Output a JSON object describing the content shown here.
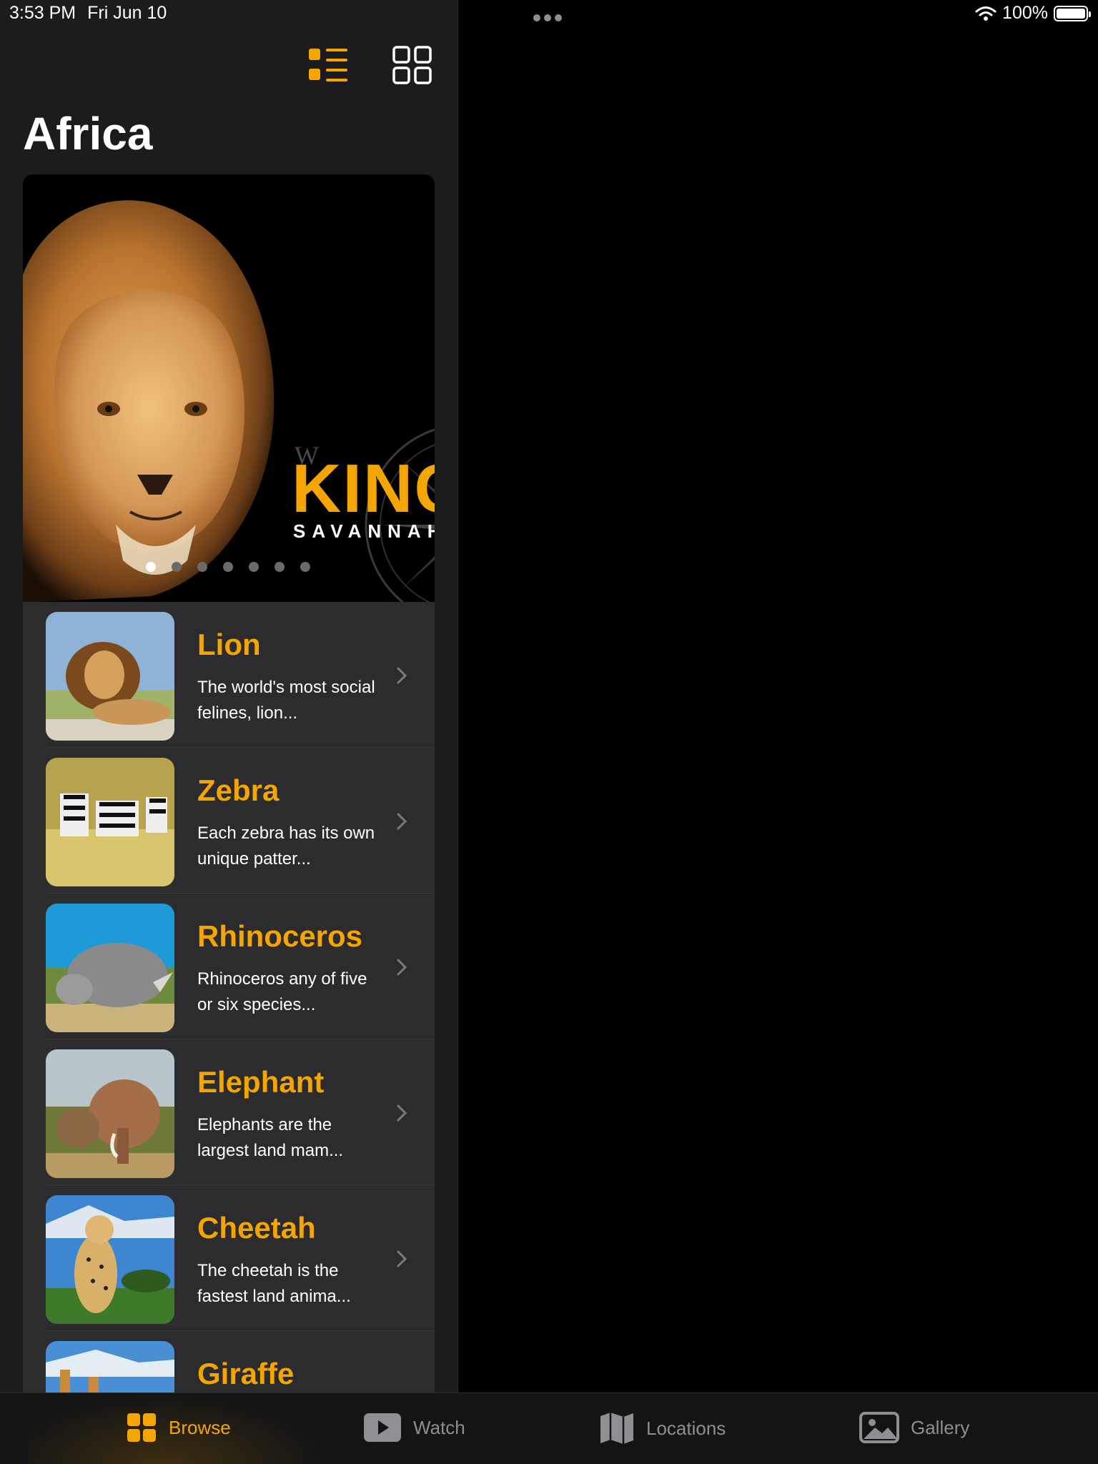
{
  "status_bar": {
    "time": "3:53 PM",
    "date": "Fri Jun 10",
    "battery": "100%"
  },
  "sidebar": {
    "title": "Africa"
  },
  "hero": {
    "title": "KING",
    "subtitle": "SAVANNAH",
    "compass_letter": "W",
    "page_count": 7,
    "active_page": 1
  },
  "animals": [
    {
      "name": "Lion",
      "description": "The world's most social felines, lion..."
    },
    {
      "name": "Zebra",
      "description": "Each zebra has its own unique patter..."
    },
    {
      "name": "Rhinoceros",
      "description": "Rhinoceros any of five or six species..."
    },
    {
      "name": "Elephant",
      "description": "Elephants are the largest land mam..."
    },
    {
      "name": "Cheetah",
      "description": "The cheetah is the fastest land anima..."
    },
    {
      "name": "Giraffe",
      "description": ""
    }
  ],
  "tabs": [
    {
      "label": "Browse",
      "icon": "grid-icon",
      "active": true
    },
    {
      "label": "Watch",
      "icon": "play-icon",
      "active": false
    },
    {
      "label": "Locations",
      "icon": "map-icon",
      "active": false
    },
    {
      "label": "Gallery",
      "icon": "photo-icon",
      "active": false
    }
  ],
  "colors": {
    "accent": "#f5a500",
    "sidebar_bg": "#1c1c1e",
    "row_bg": "#2c2c2e",
    "inactive": "#8e8e93"
  }
}
